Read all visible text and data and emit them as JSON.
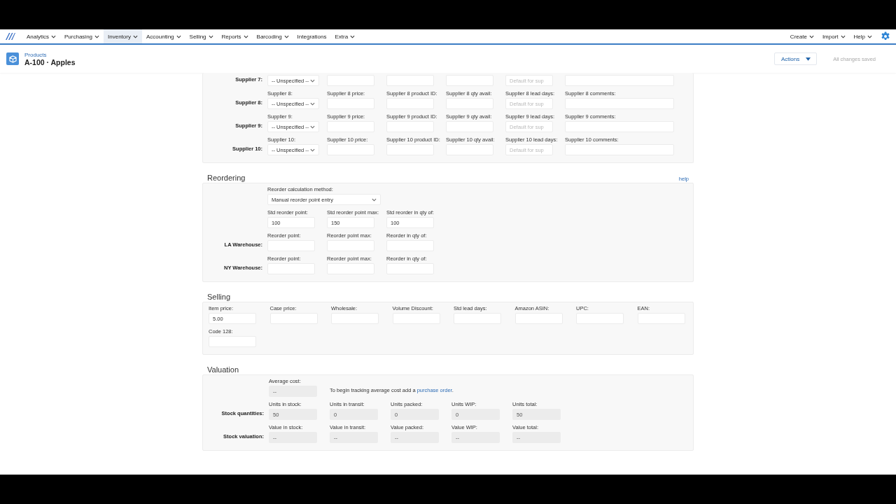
{
  "nav": {
    "left": [
      {
        "label": "Analytics",
        "has_menu": true,
        "selected": false
      },
      {
        "label": "Purchasing",
        "has_menu": true,
        "selected": false
      },
      {
        "label": "Inventory",
        "has_menu": true,
        "selected": true
      },
      {
        "label": "Accounting",
        "has_menu": true,
        "selected": false
      },
      {
        "label": "Selling",
        "has_menu": true,
        "selected": false
      },
      {
        "label": "Reports",
        "has_menu": true,
        "selected": false
      },
      {
        "label": "Barcoding",
        "has_menu": true,
        "selected": false
      },
      {
        "label": "Integrations",
        "has_menu": false,
        "selected": false
      },
      {
        "label": "Extra",
        "has_menu": true,
        "selected": false
      }
    ],
    "right": [
      {
        "label": "Create",
        "has_menu": true
      },
      {
        "label": "Import",
        "has_menu": true
      },
      {
        "label": "Help",
        "has_menu": true
      }
    ]
  },
  "header": {
    "breadcrumb": "Products",
    "title": "A-100 · Apples",
    "actions": "Actions",
    "status": "All changes saved"
  },
  "suppliers": [
    {
      "label": "Supplier 7:",
      "fields": [
        {
          "kind": "select",
          "value": "-- Unspecified --"
        },
        {
          "kind": "text"
        },
        {
          "kind": "text"
        },
        {
          "kind": "text"
        },
        {
          "kind": "text",
          "placeholder": "Default for sup"
        },
        {
          "kind": "comment"
        }
      ]
    },
    {
      "label": "Supplier 8:",
      "fields": [
        {
          "label": "Supplier 8:",
          "kind": "select",
          "value": "-- Unspecified --"
        },
        {
          "label": "Supplier 8 price:",
          "kind": "text"
        },
        {
          "label": "Supplier 8 product ID:",
          "kind": "text"
        },
        {
          "label": "Supplier 8 qty avail:",
          "kind": "text"
        },
        {
          "label": "Supplier 8 lead days:",
          "kind": "text",
          "placeholder": "Default for sup"
        },
        {
          "label": "Supplier 8 comments:",
          "kind": "comment"
        }
      ]
    },
    {
      "label": "Supplier 9:",
      "fields": [
        {
          "label": "Supplier 9:",
          "kind": "select",
          "value": "-- Unspecified --"
        },
        {
          "label": "Supplier 9 price:",
          "kind": "text"
        },
        {
          "label": "Supplier 9 product ID:",
          "kind": "text"
        },
        {
          "label": "Supplier 9 qty avail:",
          "kind": "text"
        },
        {
          "label": "Supplier 9 lead days:",
          "kind": "text",
          "placeholder": "Default for sup"
        },
        {
          "label": "Supplier 9 comments:",
          "kind": "comment"
        }
      ]
    },
    {
      "label": "Supplier 10:",
      "fields": [
        {
          "label": "Supplier 10:",
          "kind": "select",
          "value": "-- Unspecified --"
        },
        {
          "label": "Supplier 10 price:",
          "kind": "text"
        },
        {
          "label": "Supplier 10 product ID:",
          "kind": "text"
        },
        {
          "label": "Supplier 10 qty avail:",
          "kind": "text"
        },
        {
          "label": "Supplier 10 lead days:",
          "kind": "text",
          "placeholder": "Default for sup"
        },
        {
          "label": "Supplier 10 comments:",
          "kind": "comment"
        }
      ]
    }
  ],
  "reordering": {
    "title": "Reordering",
    "help": "help",
    "method": {
      "label": "Reorder calculation method:",
      "value": "Manual reorder point entry"
    },
    "rows": [
      {
        "fields": [
          {
            "label": "Std reorder point:",
            "kind": "text",
            "value": "100"
          },
          {
            "label": "Std reorder point max:",
            "kind": "text",
            "value": "150"
          },
          {
            "label": "Std reorder in qty of:",
            "kind": "text",
            "value": "100"
          }
        ]
      },
      {
        "label": "LA Warehouse:",
        "fields": [
          {
            "label": "Reorder point:",
            "kind": "text"
          },
          {
            "label": "Reorder point max:",
            "kind": "text"
          },
          {
            "label": "Reorder in qty of:",
            "kind": "text"
          }
        ]
      },
      {
        "label": "NY Warehouse:",
        "fields": [
          {
            "label": "Reorder point:",
            "kind": "text"
          },
          {
            "label": "Reorder point max:",
            "kind": "text"
          },
          {
            "label": "Reorder in qty of:",
            "kind": "text"
          }
        ]
      }
    ]
  },
  "selling": {
    "title": "Selling",
    "rows": [
      {
        "fields": [
          {
            "label": "Item price:",
            "kind": "text",
            "value": "5.00"
          },
          {
            "label": "Case price:",
            "kind": "text"
          },
          {
            "label": "Wholesale:",
            "kind": "text"
          },
          {
            "label": "Volume Discount:",
            "kind": "text"
          },
          {
            "label": "Std lead days:",
            "kind": "text"
          },
          {
            "label": "Amazon ASIN:",
            "kind": "text"
          },
          {
            "label": "UPC:",
            "kind": "text"
          },
          {
            "label": "EAN:",
            "kind": "text"
          }
        ]
      },
      {
        "fields": [
          {
            "label": "Code 128:",
            "kind": "text"
          }
        ]
      }
    ]
  },
  "valuation": {
    "title": "Valuation",
    "average": {
      "label": "Average cost:",
      "kind": "readonly",
      "value": "--"
    },
    "note": {
      "text": "To begin tracking average cost add a ",
      "link": "purchase order",
      "end": "."
    },
    "rows": [
      {
        "label": "Stock quantities:",
        "fields": [
          {
            "label": "Units in stock:",
            "kind": "readonly",
            "value": "50"
          },
          {
            "label": "Units in transit:",
            "kind": "readonly",
            "value": "0"
          },
          {
            "label": "Units packed:",
            "kind": "readonly",
            "value": "0"
          },
          {
            "label": "Units WIP:",
            "kind": "readonly",
            "value": "0"
          },
          {
            "label": "Units total:",
            "kind": "readonly",
            "value": "50"
          }
        ]
      },
      {
        "label": "Stock valuation:",
        "fields": [
          {
            "label": "Value in stock:",
            "kind": "readonly",
            "value": "--"
          },
          {
            "label": "Value in transit:",
            "kind": "readonly",
            "value": "--"
          },
          {
            "label": "Value packed:",
            "kind": "readonly",
            "value": "--"
          },
          {
            "label": "Value WIP:",
            "kind": "readonly",
            "value": "--"
          },
          {
            "label": "Value total:",
            "kind": "readonly",
            "value": "--"
          }
        ]
      }
    ]
  }
}
